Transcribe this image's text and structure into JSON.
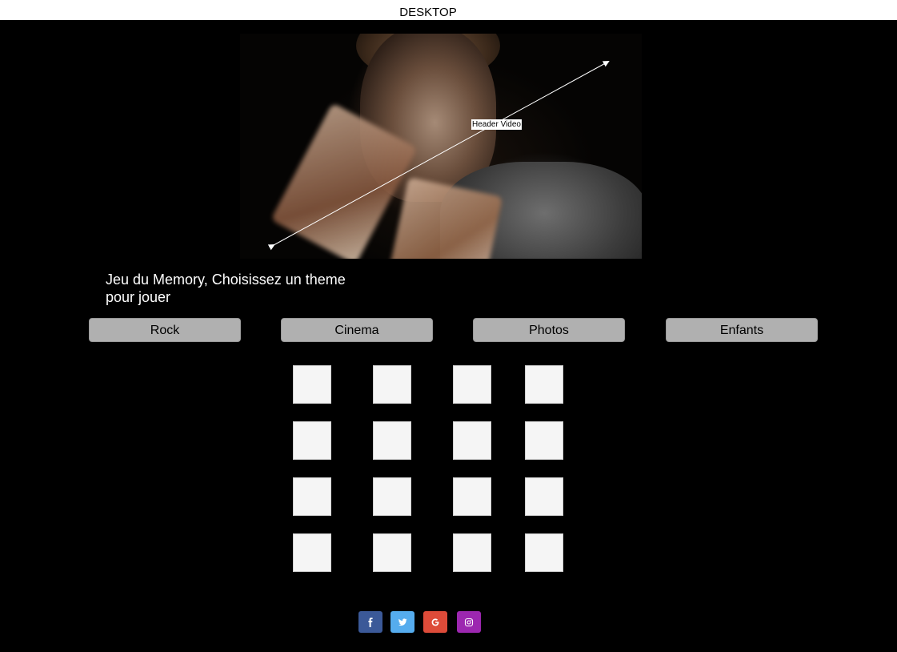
{
  "top_label": "DESKTOP",
  "hero": {
    "label": "Header Video"
  },
  "intro_text": "Jeu du Memory, Choisissez un theme pour jouer",
  "themes": [
    {
      "label": "Rock"
    },
    {
      "label": "Cinema"
    },
    {
      "label": "Photos"
    },
    {
      "label": "Enfants"
    }
  ],
  "grid": {
    "rows": 4,
    "columns": 4
  },
  "social": [
    {
      "name": "facebook-icon",
      "color": "#3b5998"
    },
    {
      "name": "twitter-icon",
      "color": "#55acee"
    },
    {
      "name": "google-icon",
      "color": "#dd4b39"
    },
    {
      "name": "instagram-icon",
      "color": "#9c27b0"
    }
  ],
  "colors": {
    "background": "#000000",
    "button": "#b0b0b0",
    "card": "#f5f5f5"
  }
}
